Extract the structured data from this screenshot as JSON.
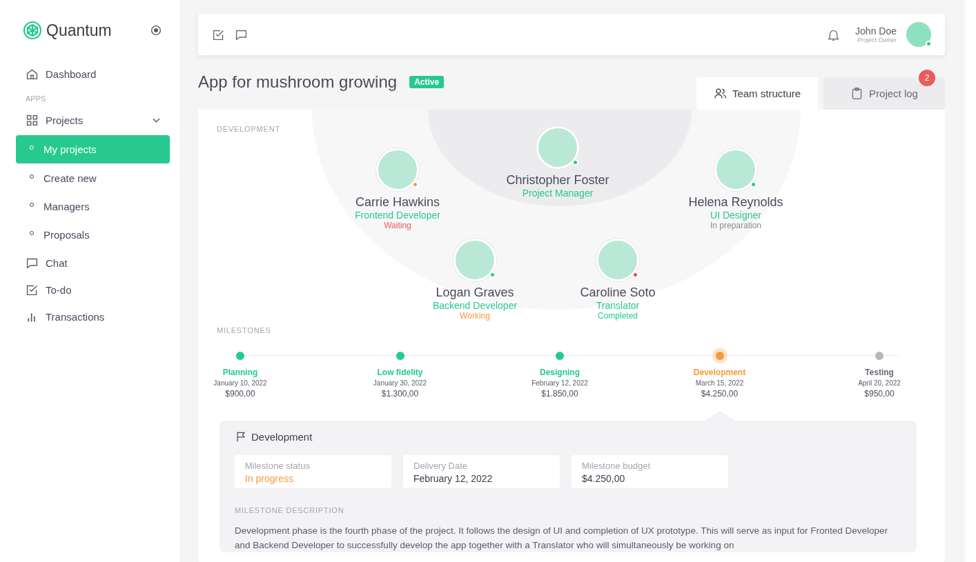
{
  "sidebar": {
    "logo": "Quantum",
    "items": [
      {
        "kind": "link",
        "label": "Dashboard",
        "selected": false
      },
      {
        "kind": "section",
        "label": "APPS"
      },
      {
        "kind": "group",
        "label": "Projects",
        "selected": false,
        "expanded": true,
        "children": [
          {
            "label": "My projects",
            "selected": true
          },
          {
            "label": "Create new",
            "selected": false
          },
          {
            "label": "Managers",
            "selected": false
          },
          {
            "label": "Proposals",
            "selected": false
          }
        ]
      },
      {
        "kind": "link",
        "label": "Chat",
        "selected": false
      },
      {
        "kind": "link",
        "label": "To-do",
        "selected": false
      },
      {
        "kind": "link",
        "label": "Transactions",
        "selected": false
      }
    ]
  },
  "header": {
    "user": {
      "name": "John Doe",
      "role": "Project Owner",
      "online": true
    }
  },
  "project": {
    "title": "App for mushroom growing",
    "status": "Active"
  },
  "tabs": [
    {
      "label": "Team structure",
      "selected": true
    },
    {
      "label": "Project log",
      "selected": false,
      "badge": "2"
    }
  ],
  "team": {
    "section": "DEVELOPMENT",
    "members": [
      {
        "name": "Christopher Foster",
        "role": "Project Manager",
        "color": "#2ecc71"
      },
      {
        "name": "Carrie Hawkins",
        "role": "Frontend Developer",
        "status": {
          "text": "Waiting",
          "color": "#ea5b5b"
        },
        "color": "#f7993c"
      },
      {
        "name": "Helena Reynolds",
        "role": "UI Designer",
        "status": {
          "text": "In preparation",
          "color": "#8b8b96"
        },
        "color": "#2ecc71"
      },
      {
        "name": "Logan Graves",
        "role": "Backend Developer",
        "status": {
          "text": "Working",
          "color": "#f7993c"
        },
        "color": "#2ecc71"
      },
      {
        "name": "Caroline Soto",
        "role": "Translator",
        "status": {
          "text": "Completed",
          "color": "#27c98f"
        },
        "color": "#ea4d4d"
      }
    ]
  },
  "milestones": {
    "section": "MILESTONES",
    "items": [
      {
        "name": "Planning",
        "date": "January 10, 2022",
        "amount": "$900,00",
        "done": true,
        "in_progress": false,
        "selected": false
      },
      {
        "name": "Low fidelity",
        "date": "January 30, 2022",
        "amount": "$1.300,00",
        "done": true,
        "in_progress": false,
        "selected": false
      },
      {
        "name": "Designing",
        "date": "February 12, 2022",
        "amount": "$1.850,00",
        "done": true,
        "in_progress": false,
        "selected": false
      },
      {
        "name": "Development",
        "date": "March 15, 2022",
        "amount": "$4.250,00",
        "in_progress": true,
        "selected": true
      },
      {
        "name": "Testing",
        "date": "April 20, 2022",
        "amount": "$950,00",
        "done": false,
        "in_progress": false,
        "selected": false
      }
    ]
  },
  "detail": {
    "title": "Development",
    "fields": [
      {
        "label": "Milestone status",
        "value": "In progress",
        "kind": "status"
      },
      {
        "label": "Delivery Date",
        "value": "February 12, 2022",
        "kind": "plain"
      },
      {
        "label": "Milestone budget",
        "value": "$4.250,00",
        "kind": "plain"
      }
    ],
    "description_label": "MILESTONE DESCRIPTION",
    "description": "Development phase is the fourth phase of the project. It follows the design of UI and completion of UX prototype. This will serve as input for Fronted Developer and Backend Developer to successfully develop the app together with a Translator who will simultaneously be working on"
  }
}
